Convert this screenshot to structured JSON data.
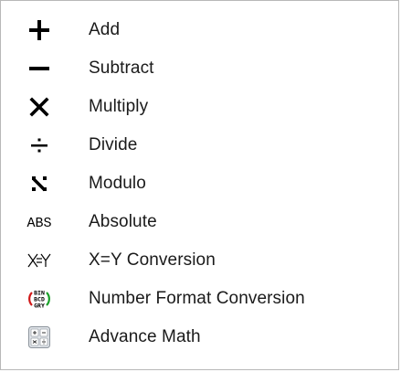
{
  "menu": {
    "items": [
      {
        "label": "Add",
        "icon": "plus-icon"
      },
      {
        "label": "Subtract",
        "icon": "minus-icon"
      },
      {
        "label": "Multiply",
        "icon": "multiply-icon"
      },
      {
        "label": "Divide",
        "icon": "divide-icon"
      },
      {
        "label": "Modulo",
        "icon": "modulo-icon"
      },
      {
        "label": "Absolute",
        "icon": "abs-icon",
        "icon_text": "ABS"
      },
      {
        "label": "X=Y  Conversion",
        "icon": "x-equals-y-icon"
      },
      {
        "label": "Number Format Conversion",
        "icon": "number-format-icon",
        "icon_text": [
          "BIN",
          "BCD",
          "GRY"
        ]
      },
      {
        "label": "Advance Math",
        "icon": "advance-math-icon"
      }
    ]
  },
  "colors": {
    "text": "#1a1a1a",
    "icon": "#000000",
    "border": "#b8b8b8",
    "number_format_red": "#d01818",
    "number_format_green": "#18a028"
  }
}
